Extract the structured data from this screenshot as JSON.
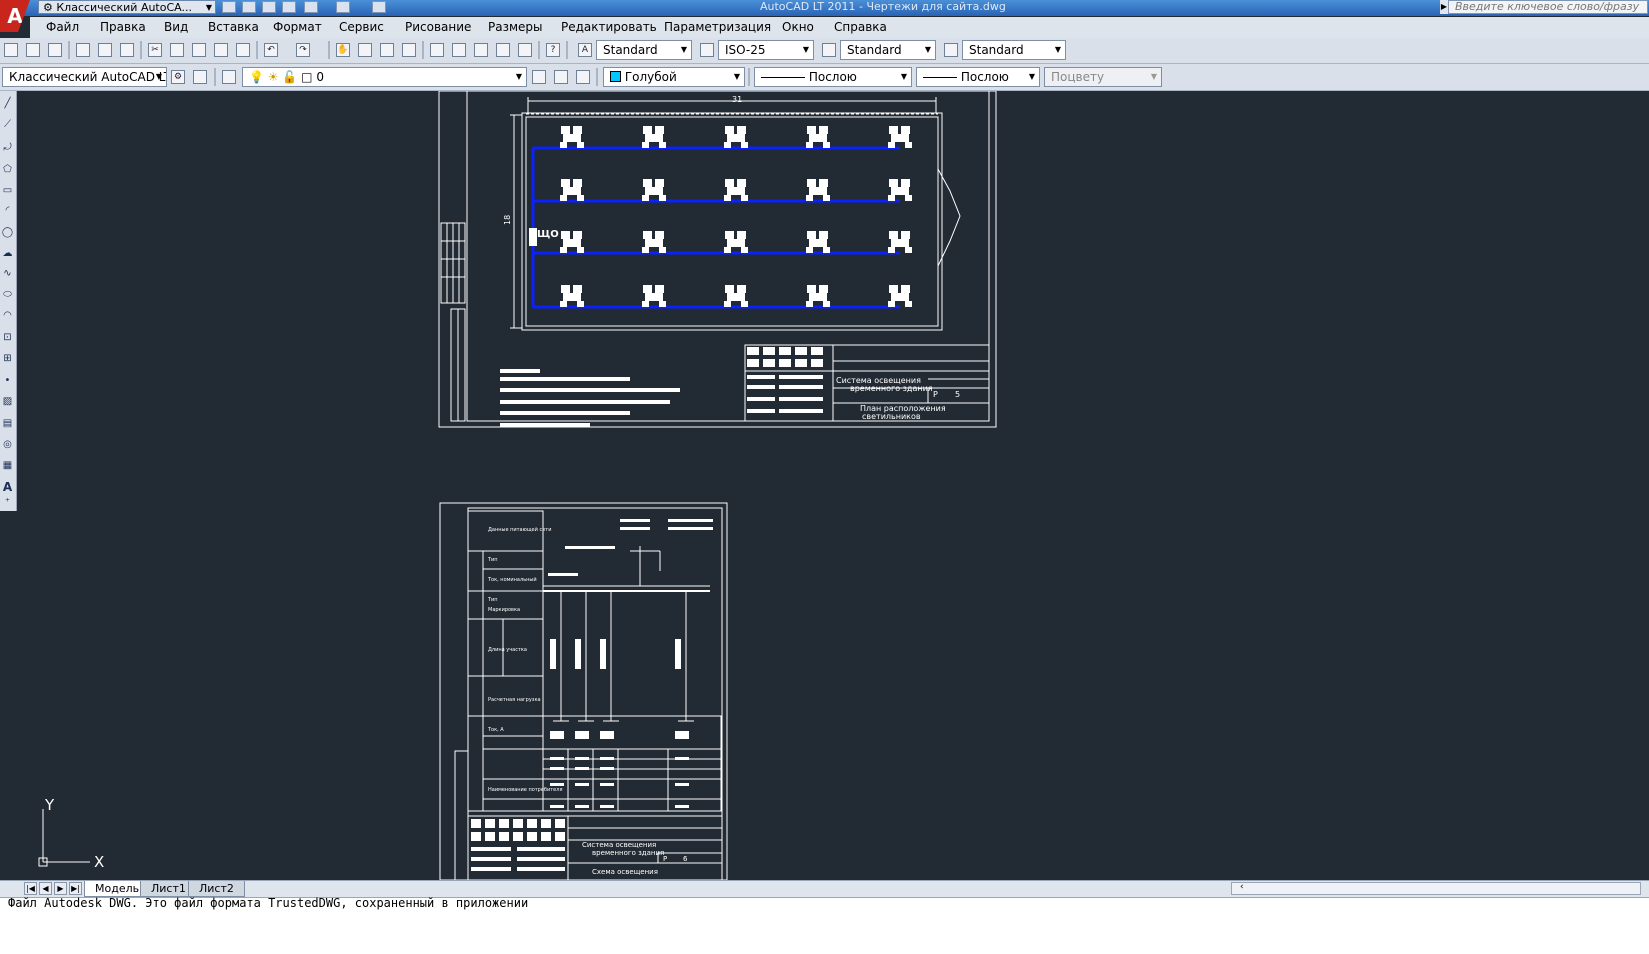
{
  "titlebar": {
    "workspace": "Классический AutoCA...",
    "title": "AutoCAD LT 2011 - Чертежи для сайта.dwg",
    "search_placeholder": "Введите ключевое слово/фразу"
  },
  "menu": [
    "Файл",
    "Правка",
    "Вид",
    "Вставка",
    "Формат",
    "Сервис",
    "Рисование",
    "Размеры",
    "Редактировать",
    "Параметризация",
    "Окно",
    "Справка"
  ],
  "toolbar1": {
    "text_style": "Standard",
    "dim_style": "ISO-25",
    "table_style": "Standard",
    "mleader_style": "Standard"
  },
  "toolbar2": {
    "workspace": "Классический AutoCAD LT",
    "layer": "0",
    "color": "Голубой",
    "color_hex": "#00c8ff",
    "linetype": "Послою",
    "lineweight": "Послою",
    "plotstyle": "Поцвету"
  },
  "drawing": {
    "dim_width": "31",
    "dim_height": "18",
    "panel_label": "ЩО",
    "wire_color": "#0a22ff",
    "sheet1_title": [
      "Система освещения",
      "временного здания",
      "План расположения",
      "светильников"
    ],
    "sheet1_stage": "Р",
    "sheet1_sheet": "5",
    "sheet2_title": [
      "Система освещения",
      "временного здания",
      "Схема освещения"
    ],
    "sheet2_stage": "Р",
    "sheet2_sheet": "6",
    "sheet2_rows": [
      "Данные питающей сети",
      "Тип",
      "Ток, номинальный",
      "Тип",
      "Маркировка",
      "Длина участка",
      "Расчетная нагрузка",
      "Ток, А",
      "Наименование потребителя"
    ],
    "ucs_x": "X",
    "ucs_y": "Y"
  },
  "tabs": [
    "Модель",
    "Лист1",
    "Лист2"
  ],
  "active_tab": "Модель",
  "command_line": "Файл Autodesk DWG. Это файл формата TrustedDWG, сохраненный в приложении"
}
